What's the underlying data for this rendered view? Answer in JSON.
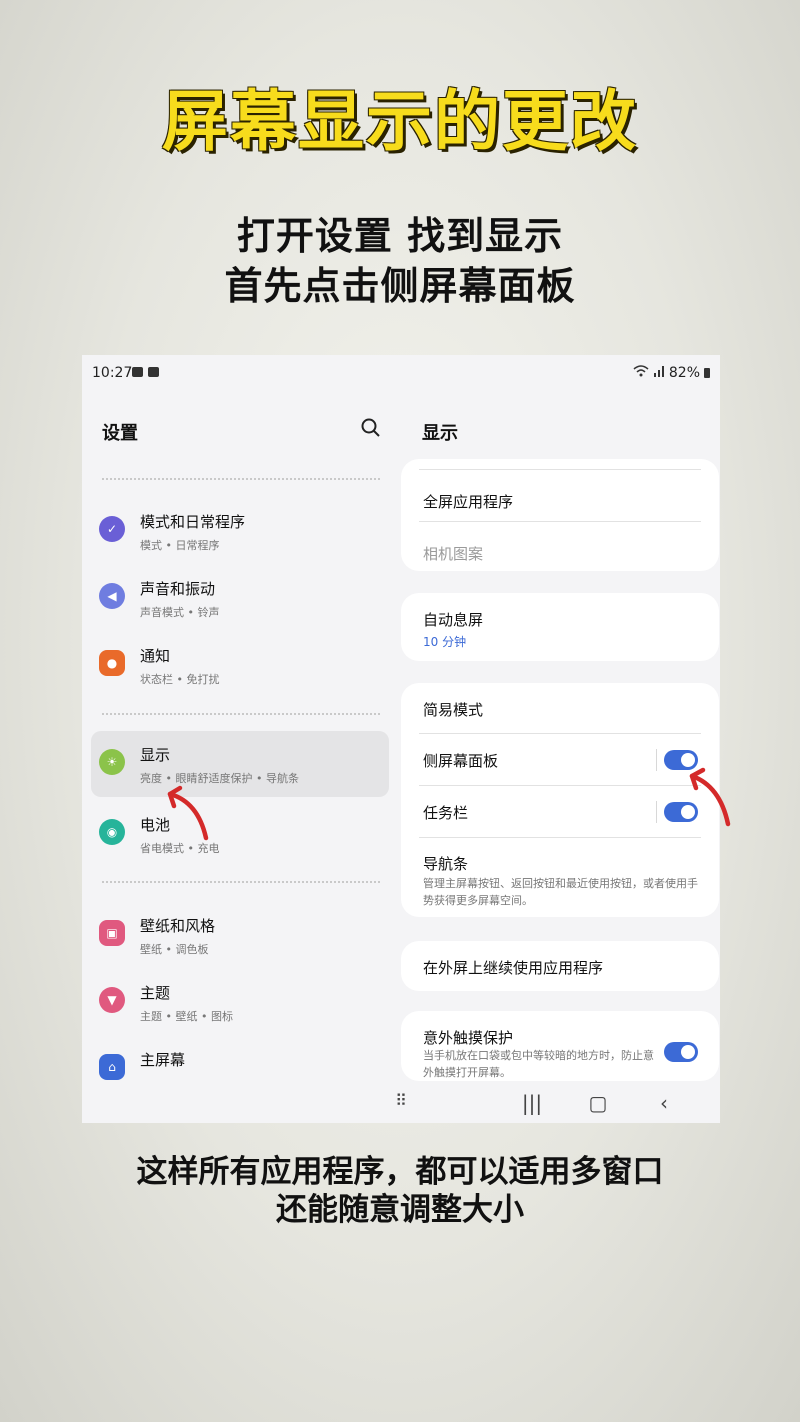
{
  "headline": "屏幕显示的更改",
  "subtitle": [
    "打开设置 找到显示",
    "首先点击侧屏幕面板"
  ],
  "caption": [
    "这样所有应用程序，都可以适用多窗口",
    "还能随意调整大小"
  ],
  "status": {
    "time": "10:27",
    "battery": "82%"
  },
  "left": {
    "title": "设置",
    "items": [
      {
        "title": "模式和日常程序",
        "sub": "模式 • 日常程序",
        "color": "#6a5fd6"
      },
      {
        "title": "声音和振动",
        "sub": "声音模式 • 铃声",
        "color": "#6f7de0"
      },
      {
        "title": "通知",
        "sub": "状态栏 • 免打扰",
        "color": "#e96a2a"
      },
      {
        "title": "显示",
        "sub": "亮度 • 眼睛舒适度保护 • 导航条",
        "color": "#8bc34a"
      },
      {
        "title": "电池",
        "sub": "省电模式 • 充电",
        "color": "#26b49a"
      },
      {
        "title": "壁纸和风格",
        "sub": "壁纸 • 调色板",
        "color": "#e0597f"
      },
      {
        "title": "主题",
        "sub": "主题 • 壁纸 • 图标",
        "color": "#e0597f"
      },
      {
        "title": "主屏幕",
        "sub": "",
        "color": "#3c6ad6"
      }
    ]
  },
  "right": {
    "title": "显示",
    "fullscreen_apps": "全屏应用程序",
    "camera_cutout": "相机图案",
    "screen_timeout": "自动息屏",
    "screen_timeout_value": "10 分钟",
    "easy_mode": "简易模式",
    "edge_panels": "侧屏幕面板",
    "edge_panels_on": true,
    "taskbar": "任务栏",
    "taskbar_on": true,
    "navbar": "导航条",
    "navbar_desc": "管理主屏幕按钮、返回按钮和最近使用按钮，或者使用手势获得更多屏幕空间。",
    "cover_screen": "在外屏上继续使用应用程序",
    "accidental_touch": "意外触摸保护",
    "accidental_touch_desc": "当手机放在口袋或包中等较暗的地方时，防止意外触摸打开屏幕。",
    "accidental_touch_on": true
  },
  "colors": {
    "accent": "#3c6ad6",
    "annotation": "#d42a2a",
    "headline": "#f7dc1c"
  }
}
